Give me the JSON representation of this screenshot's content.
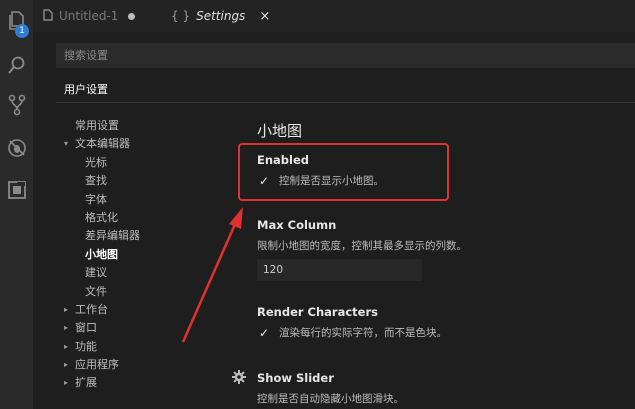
{
  "tabs": [
    {
      "label": "Untitled-1",
      "icon": "file-icon",
      "dirty": true
    },
    {
      "label": "Settings",
      "icon": "braces-icon",
      "close": "×"
    }
  ],
  "activity_badge": "1",
  "search": {
    "placeholder": "搜索设置"
  },
  "scope_tab": "用户设置",
  "toc": [
    {
      "label": "常用设置",
      "level": 0,
      "arrow": ""
    },
    {
      "label": "文本编辑器",
      "level": 0,
      "arrow": "▾"
    },
    {
      "label": "光标",
      "level": 1
    },
    {
      "label": "查找",
      "level": 1
    },
    {
      "label": "字体",
      "level": 1
    },
    {
      "label": "格式化",
      "level": 1
    },
    {
      "label": "差异编辑器",
      "level": 1
    },
    {
      "label": "小地图",
      "level": 1,
      "selected": true
    },
    {
      "label": "建议",
      "level": 1
    },
    {
      "label": "文件",
      "level": 1
    },
    {
      "label": "工作台",
      "level": 0,
      "arrow": "▸"
    },
    {
      "label": "窗口",
      "level": 0,
      "arrow": "▸"
    },
    {
      "label": "功能",
      "level": 0,
      "arrow": "▸"
    },
    {
      "label": "应用程序",
      "level": 0,
      "arrow": "▸"
    },
    {
      "label": "扩展",
      "level": 0,
      "arrow": "▸"
    }
  ],
  "section_title": "小地图",
  "settings": {
    "enabled": {
      "title": "Enabled",
      "desc": "控制是否显示小地图。",
      "checked": true
    },
    "max_column": {
      "title": "Max Column",
      "desc": "限制小地图的宽度，控制其最多显示的列数。",
      "value": "120"
    },
    "render_characters": {
      "title": "Render Characters",
      "desc": "渲染每行的实际字符，而不是色块。",
      "checked": true
    },
    "show_slider": {
      "title": "Show Slider",
      "desc": "控制是否自动隐藏小地图滑块。"
    }
  },
  "colors": {
    "annotation": "#e03131",
    "accent": "#2d7dd2",
    "background": "#1e1e1e"
  }
}
